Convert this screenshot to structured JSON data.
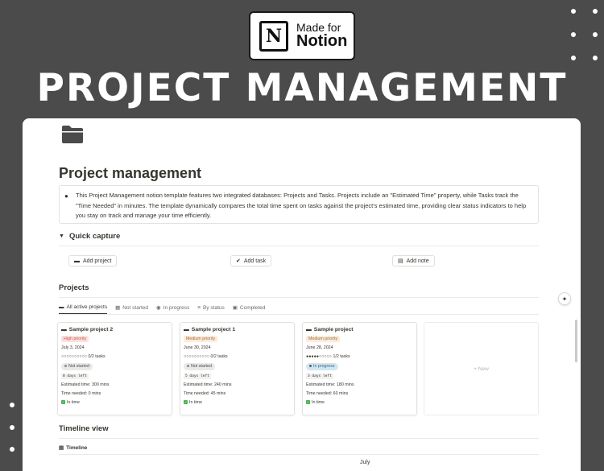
{
  "badge": {
    "logo": "N",
    "line1": "Made for",
    "line2": "Notion"
  },
  "promo_title": "PROJECT MANAGEMENT",
  "page": {
    "icon": "folder-icon",
    "title": "Project management",
    "callout": {
      "icon": "speech-bubble-icon",
      "text": "This Project Management notion template features two integrated databases: Projects and Tasks. Projects include an \"Estimated Time\" property, while Tasks track the \"Time Needed\" in minutes. The template dynamically compares the total time spent on tasks against the project's estimated time, providing clear status indicators to help you stay on track and manage your time efficiently."
    },
    "quick_capture": {
      "title": "Quick capture",
      "buttons": [
        {
          "label": "Add project",
          "icon": "folder-icon"
        },
        {
          "label": "Add task",
          "icon": "check-circle-icon"
        },
        {
          "label": "Add note",
          "icon": "note-icon"
        }
      ]
    },
    "projects": {
      "title": "Projects",
      "tabs": [
        {
          "label": "All active projects",
          "icon": "folder-icon"
        },
        {
          "label": "Not started",
          "icon": "table-icon"
        },
        {
          "label": "In progress",
          "icon": "play-icon"
        },
        {
          "label": "By status",
          "icon": "stack-icon"
        },
        {
          "label": "Completed",
          "icon": "archive-icon"
        }
      ],
      "cards": [
        {
          "title": "Sample project 2",
          "priority": "High priority",
          "date": "July 3, 2024",
          "progress": "○○○○○○○○○○ 0/2 tasks",
          "status": "Not started",
          "days": "8 days left",
          "estimated": "Estimated time: 300 mins",
          "needed": "Time needed: 0 mins",
          "in_time": "In time"
        },
        {
          "title": "Sample project 1",
          "priority": "Medium priority",
          "date": "June 30, 2024",
          "progress": "○○○○○○○○○○ 0/2 tasks",
          "status": "Not started",
          "days": "5 days left",
          "estimated": "Estimated time: 240 mins",
          "needed": "Time needed: 45 mins",
          "in_time": "In time"
        },
        {
          "title": "Sample project",
          "priority": "Medium priority",
          "date": "June 28, 2024",
          "progress": "●●●●●○○○○○ 1/2 tasks",
          "status": "In progress",
          "days": "3 days left",
          "estimated": "Estimated time: 180 mins",
          "needed": "Time needed: 60 mins",
          "in_time": "In time"
        }
      ],
      "new_label": "+ New"
    },
    "timeline": {
      "title": "Timeline view",
      "tab": "Timeline",
      "month": "July"
    }
  }
}
